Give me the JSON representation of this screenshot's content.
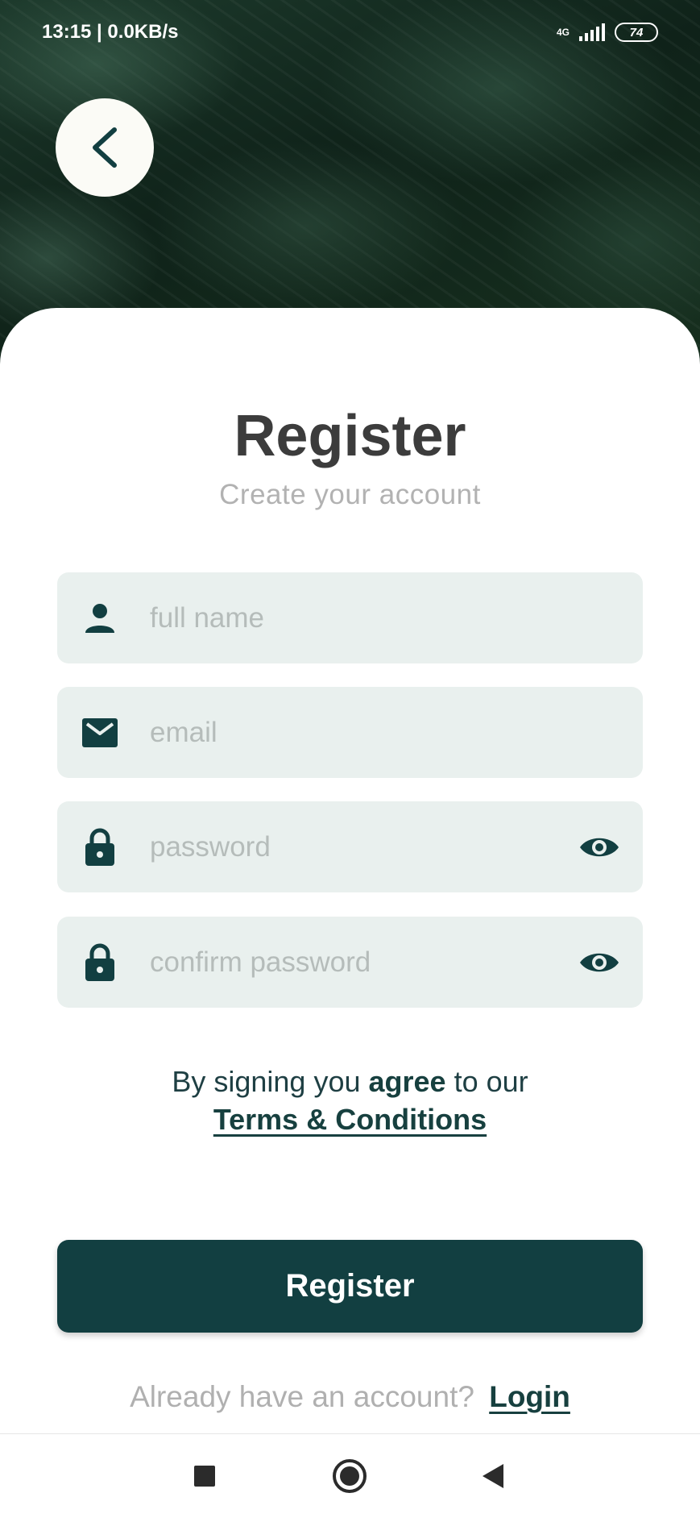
{
  "status_bar": {
    "time": "13:15 | 0.0KB/s",
    "network": "4G",
    "battery": "74"
  },
  "header": {
    "back_icon": "chevron-left-icon"
  },
  "main": {
    "title": "Register",
    "subtitle": "Create your account"
  },
  "form": {
    "full_name": {
      "placeholder": "full name",
      "value": "",
      "icon": "person-icon"
    },
    "email": {
      "placeholder": "email",
      "value": "",
      "icon": "envelope-icon"
    },
    "password": {
      "placeholder": "password",
      "value": "",
      "icon": "lock-icon",
      "toggle_icon": "eye-icon"
    },
    "confirm_password": {
      "placeholder": "confirm password",
      "value": "",
      "icon": "lock-icon",
      "toggle_icon": "eye-icon"
    }
  },
  "agreement": {
    "prefix": "By signing you ",
    "emphasis": "agree",
    "suffix": " to our",
    "terms_link": "Terms & Conditions"
  },
  "register_button": {
    "label": "Register"
  },
  "login_prompt": {
    "text": "Already have an account?",
    "link": "Login"
  },
  "system_nav": {
    "recents_icon": "square-icon",
    "home_icon": "circle-icon",
    "back_icon": "triangle-back-icon"
  },
  "colors": {
    "primary": "#123f41",
    "field_bg": "#e9f0ee",
    "title": "#3c3c3c",
    "muted": "#b2b2b2"
  }
}
